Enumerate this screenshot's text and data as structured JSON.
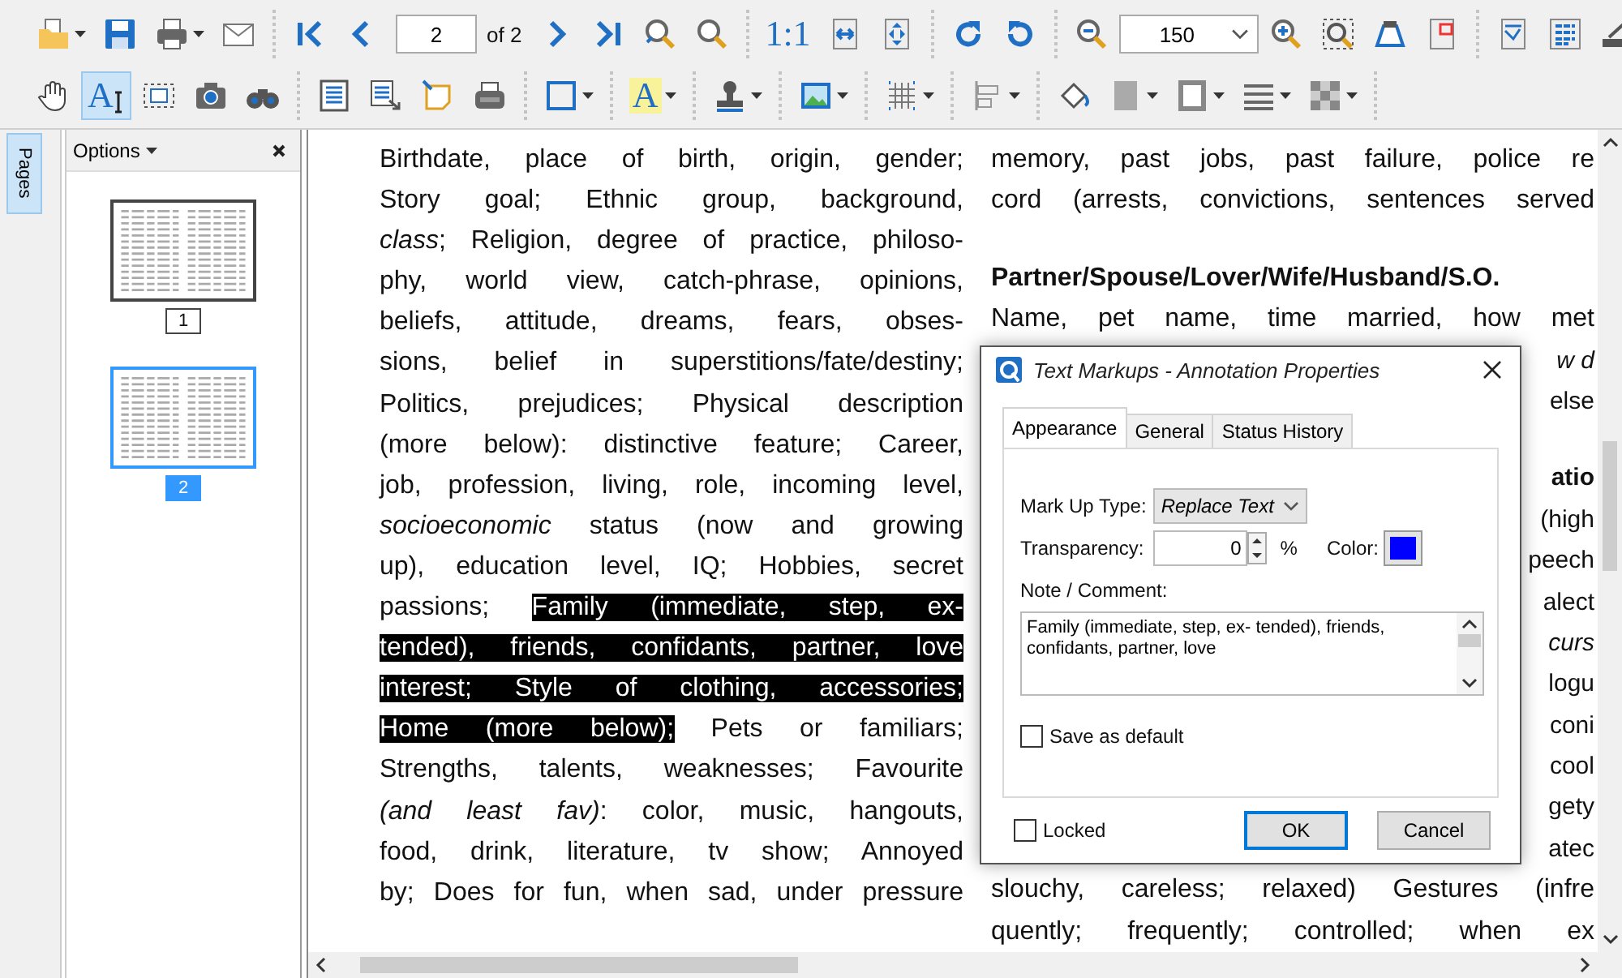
{
  "toolbar": {
    "rows": [
      [
        [
          {
            "kind": "open",
            "dropdown": true,
            "selected": false
          },
          {
            "kind": "save",
            "dropdown": false,
            "selected": false
          },
          {
            "kind": "print",
            "dropdown": true,
            "selected": false
          },
          {
            "kind": "email",
            "dropdown": false,
            "selected": false
          }
        ],
        [
          {
            "kind": "first",
            "dropdown": false,
            "selected": false
          },
          {
            "kind": "prev",
            "dropdown": false,
            "selected": false
          },
          {
            "kind": "page-field",
            "value": "2"
          },
          {
            "kind": "page-count",
            "text": "of 2"
          },
          {
            "kind": "next",
            "dropdown": false,
            "selected": false
          },
          {
            "kind": "last",
            "dropdown": false,
            "selected": false
          },
          {
            "kind": "find-prev",
            "dropdown": false,
            "selected": false
          },
          {
            "kind": "find-next",
            "dropdown": false,
            "selected": false
          }
        ],
        [
          {
            "kind": "actual-size",
            "label": "1:1",
            "dropdown": false,
            "selected": false
          },
          {
            "kind": "fit-width",
            "dropdown": false,
            "selected": false
          },
          {
            "kind": "fit-page",
            "dropdown": false,
            "selected": false
          }
        ],
        [
          {
            "kind": "rotate-cw",
            "dropdown": false,
            "selected": false
          },
          {
            "kind": "rotate-ccw",
            "dropdown": false,
            "selected": false
          }
        ],
        [
          {
            "kind": "zoom-out",
            "dropdown": false,
            "selected": false
          },
          {
            "kind": "zoom-combo",
            "value": "150"
          },
          {
            "kind": "zoom-in",
            "dropdown": false,
            "selected": false
          },
          {
            "kind": "marquee-zoom",
            "dropdown": false,
            "selected": false
          },
          {
            "kind": "inkwell",
            "dropdown": false,
            "selected": false
          },
          {
            "kind": "page-frame",
            "dropdown": false,
            "selected": false
          }
        ],
        [
          {
            "kind": "snapshot-doc",
            "dropdown": false,
            "selected": false
          },
          {
            "kind": "text-doc",
            "dropdown": false,
            "selected": false
          },
          {
            "kind": "scanner",
            "dropdown": false,
            "selected": false
          }
        ]
      ],
      [
        [
          {
            "kind": "hand",
            "dropdown": false,
            "selected": false
          },
          {
            "kind": "text-select",
            "label": "A",
            "dropdown": false,
            "selected": true
          },
          {
            "kind": "select-area",
            "dropdown": false,
            "selected": false
          },
          {
            "kind": "camera",
            "dropdown": false,
            "selected": false
          },
          {
            "kind": "binoculars",
            "dropdown": false,
            "selected": false
          }
        ],
        [
          {
            "kind": "document",
            "dropdown": false,
            "selected": false
          },
          {
            "kind": "doc-export",
            "dropdown": false,
            "selected": false
          },
          {
            "kind": "sticky-note",
            "dropdown": false,
            "selected": false
          },
          {
            "kind": "typewriter",
            "dropdown": false,
            "selected": false
          }
        ],
        [
          {
            "kind": "rectangle",
            "dropdown": true,
            "selected": false
          }
        ],
        [
          {
            "kind": "highlight",
            "label": "A",
            "dropdown": true,
            "selected": false
          }
        ],
        [
          {
            "kind": "stamp",
            "dropdown": true,
            "selected": false
          }
        ],
        [
          {
            "kind": "image",
            "dropdown": true,
            "selected": false
          }
        ],
        [
          {
            "kind": "grid",
            "dropdown": true,
            "selected": false
          }
        ],
        [
          {
            "kind": "align",
            "dropdown": true,
            "selected": false
          }
        ],
        [
          {
            "kind": "fill-bucket",
            "dropdown": false,
            "selected": false
          },
          {
            "kind": "fill-color",
            "dropdown": true,
            "selected": false
          },
          {
            "kind": "border",
            "dropdown": true,
            "selected": false
          },
          {
            "kind": "lines",
            "dropdown": true,
            "selected": false
          },
          {
            "kind": "pattern",
            "dropdown": true,
            "selected": false
          }
        ]
      ]
    ]
  },
  "sidebar": {
    "tabs": [
      {
        "label": "Pages",
        "selected": true
      }
    ],
    "header": "Options",
    "pages": [
      {
        "label": "1",
        "selected": false
      },
      {
        "label": "2",
        "selected": true
      }
    ]
  },
  "document": {
    "left_column": [
      {
        "segments": [
          {
            "text": "Birthdate, place of birth, origin, gender;",
            "highlighted": false
          }
        ]
      },
      {
        "segments": [
          {
            "text": "Story goal; Ethnic group, background,",
            "highlighted": false
          }
        ]
      },
      {
        "segments": [
          {
            "text": "*class*; Religion, degree of practice, philoso-",
            "highlighted": false
          }
        ]
      },
      {
        "segments": [
          {
            "text": "phy, world view, catch-phrase, opinions,",
            "highlighted": false
          }
        ]
      },
      {
        "segments": [
          {
            "text": "beliefs, attitude, dreams, fears, obses-",
            "highlighted": false
          }
        ]
      },
      {
        "segments": [
          {
            "text": "sions, belief in superstitions/fate/destiny;",
            "highlighted": false
          }
        ]
      },
      {
        "segments": [
          {
            "text": "Politics, prejudices; Physical description",
            "highlighted": false
          }
        ]
      },
      {
        "segments": [
          {
            "text": "(more below): distinctive feature; Career,",
            "highlighted": false
          }
        ]
      },
      {
        "segments": [
          {
            "text": "job, profession, living, role, incoming level,",
            "highlighted": false
          }
        ]
      },
      {
        "segments": [
          {
            "text": "*socioeconomic* status (now and growing",
            "highlighted": false
          }
        ]
      },
      {
        "segments": [
          {
            "text": "up), education level, IQ;  Hobbies, secret",
            "highlighted": false
          }
        ]
      },
      {
        "segments": [
          {
            "text": "passions; ",
            "highlighted": false
          },
          {
            "text": "Family (immediate, step, ex-",
            "highlighted": true
          }
        ]
      },
      {
        "segments": [
          {
            "text": "tended), friends, confidants, partner, love",
            "highlighted": true
          }
        ]
      },
      {
        "segments": [
          {
            "text": "interest; Style of clothing, accessories;",
            "highlighted": true
          }
        ]
      },
      {
        "segments": [
          {
            "text": "Home (more below);",
            "highlighted": true
          },
          {
            "text": " Pets or familiars;",
            "highlighted": false
          }
        ]
      },
      {
        "segments": [
          {
            "text": "Strengths, talents, weaknesses; Favourite",
            "highlighted": false
          }
        ]
      },
      {
        "segments": [
          {
            "text": "*(and least fav)*: color, music, hangouts,",
            "highlighted": false
          }
        ]
      },
      {
        "segments": [
          {
            "text": "food, drink, literature, tv show; Annoyed",
            "highlighted": false
          }
        ]
      },
      {
        "segments": [
          {
            "text": "by; Does for fun, when sad, under pressure",
            "highlighted": false
          }
        ]
      }
    ],
    "right_column": [
      {
        "kind": "line",
        "text": "memory, past jobs, past failure, police re"
      },
      {
        "kind": "line",
        "text": "cord (arrests, convictions, sentences served"
      },
      {
        "kind": "gap"
      },
      {
        "kind": "heading",
        "text": "Partner/Spouse/Lover/Wife/Husband/S.O."
      },
      {
        "kind": "line",
        "text": "Name, pet name, time married, how met"
      },
      {
        "kind": "fragment",
        "text": "*w d*"
      },
      {
        "kind": "fragment",
        "text": "else"
      },
      {
        "kind": "gap"
      },
      {
        "kind": "fragment",
        "text": "**atio**"
      },
      {
        "kind": "fragment",
        "text": "(high"
      },
      {
        "kind": "fragment",
        "text": "peech"
      },
      {
        "kind": "fragment",
        "text": "alect"
      },
      {
        "kind": "fragment",
        "text": "*curs*"
      },
      {
        "kind": "fragment",
        "text": "logu"
      },
      {
        "kind": "fragment",
        "text": "coni"
      },
      {
        "kind": "fragment",
        "text": "cool"
      },
      {
        "kind": "fragment",
        "text": "gety"
      },
      {
        "kind": "fragment",
        "text": "atec"
      },
      {
        "kind": "line",
        "text": "slouchy, careless; relaxed) Gestures (infre"
      },
      {
        "kind": "line",
        "text": "quently; frequently; controlled; when ex"
      }
    ]
  },
  "dialog": {
    "title": "Text Markups - Annotation Properties",
    "tabs": [
      {
        "label": "Appearance",
        "selected": true
      },
      {
        "label": "General",
        "selected": false
      },
      {
        "label": "Status History",
        "selected": false
      }
    ],
    "markup_type": {
      "label": "Mark Up Type:",
      "value": "Replace Text"
    },
    "transparency": {
      "label": "Transparency:",
      "value": "0",
      "unit": "%"
    },
    "color": {
      "label": "Color:",
      "color": "#0000ff"
    },
    "note": {
      "label": "Note / Comment:",
      "value": "Family (immediate, step, ex- tended), friends, confidants, partner, love"
    },
    "save_default": {
      "label": "Save as default",
      "checked": false
    },
    "locked": {
      "label": "Locked",
      "checked": false
    },
    "buttons": [
      {
        "label": "OK",
        "default": true
      },
      {
        "label": "Cancel",
        "default": false
      }
    ]
  }
}
